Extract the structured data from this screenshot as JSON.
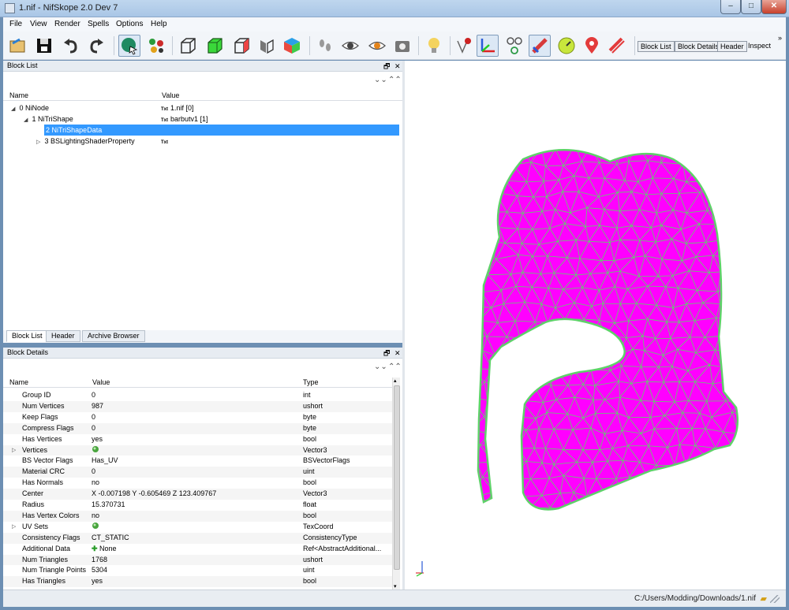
{
  "window": {
    "title": "1.nif - NifSkope 2.0 Dev 7",
    "min_label": "–",
    "max_label": "□",
    "close_label": "✕"
  },
  "menu": [
    "File",
    "View",
    "Render",
    "Spells",
    "Options",
    "Help"
  ],
  "toolbar": {
    "tabs": [
      "Block List",
      "Block Details",
      "Header"
    ],
    "inspect_label": "Inspect",
    "more_label": "»",
    "icons": [
      "load-icon",
      "save-icon",
      "undo-icon",
      "redo-icon",
      "select-object-icon",
      "select-vertex-icon",
      "wireframe-icon",
      "solid-icon",
      "outline-icon",
      "flip-icon",
      "textured-cube-icon",
      "footprints-icon",
      "eye-icon",
      "eye-orange-icon",
      "camera-icon",
      "lightbulb-icon",
      "vertex-marker-icon",
      "axes-icon",
      "nodes-icon",
      "constraint-icon",
      "gauge-icon",
      "location-pin-icon",
      "hide-icon"
    ]
  },
  "block_list": {
    "title": "Block List",
    "float_label": "🗗",
    "close_label": "✕",
    "columns": [
      "Name",
      "Value"
    ],
    "rows": [
      {
        "name": "0 NiNode",
        "value": "1.nif [0]",
        "tag": "Txt"
      },
      {
        "name": "1 NiTriShape",
        "value": "barbutv1 [1]",
        "tag": "Txt"
      },
      {
        "name": "2 NiTriShapeData",
        "value": "",
        "tag": ""
      },
      {
        "name": "3 BSLightingShaderProperty",
        "value": "",
        "tag": "Txt"
      }
    ],
    "bottom_tabs": [
      "Block List",
      "Header",
      "Archive Browser"
    ]
  },
  "block_details": {
    "title": "Block Details",
    "float_label": "🗗",
    "close_label": "✕",
    "columns": [
      "Name",
      "Value",
      "Type"
    ],
    "rows": [
      {
        "name": "Group ID",
        "value": "0",
        "type": "int"
      },
      {
        "name": "Num Vertices",
        "value": "987",
        "type": "ushort"
      },
      {
        "name": "Keep Flags",
        "value": "0",
        "type": "byte"
      },
      {
        "name": "Compress Flags",
        "value": "0",
        "type": "byte"
      },
      {
        "name": "Has Vertices",
        "value": "yes",
        "type": "bool"
      },
      {
        "name": "Vertices",
        "value": "",
        "type": "Vector3"
      },
      {
        "name": "BS Vector Flags",
        "value": "Has_UV",
        "type": "BSVectorFlags"
      },
      {
        "name": "Material CRC",
        "value": "0",
        "type": "uint"
      },
      {
        "name": "Has Normals",
        "value": "no",
        "type": "bool"
      },
      {
        "name": "Center",
        "value": "X -0.007198 Y -0.605469 Z 123.409767",
        "type": "Vector3"
      },
      {
        "name": "Radius",
        "value": "15.370731",
        "type": "float"
      },
      {
        "name": "Has Vertex Colors",
        "value": "no",
        "type": "bool"
      },
      {
        "name": "UV Sets",
        "value": "",
        "type": "TexCoord"
      },
      {
        "name": "Consistency Flags",
        "value": "CT_STATIC",
        "type": "ConsistencyType"
      },
      {
        "name": "Additional Data",
        "value": "None",
        "type": "Ref<AbstractAdditional..."
      },
      {
        "name": "Num Triangles",
        "value": "1768",
        "type": "ushort"
      },
      {
        "name": "Num Triangle Points",
        "value": "5304",
        "type": "uint"
      },
      {
        "name": "Has Triangles",
        "value": "yes",
        "type": "bool"
      }
    ]
  },
  "viewport": {
    "mesh_fill": "#ff00ff",
    "wire_color": "#5fd16a"
  },
  "status": {
    "path": "C:/Users/Modding/Downloads/1.nif"
  }
}
